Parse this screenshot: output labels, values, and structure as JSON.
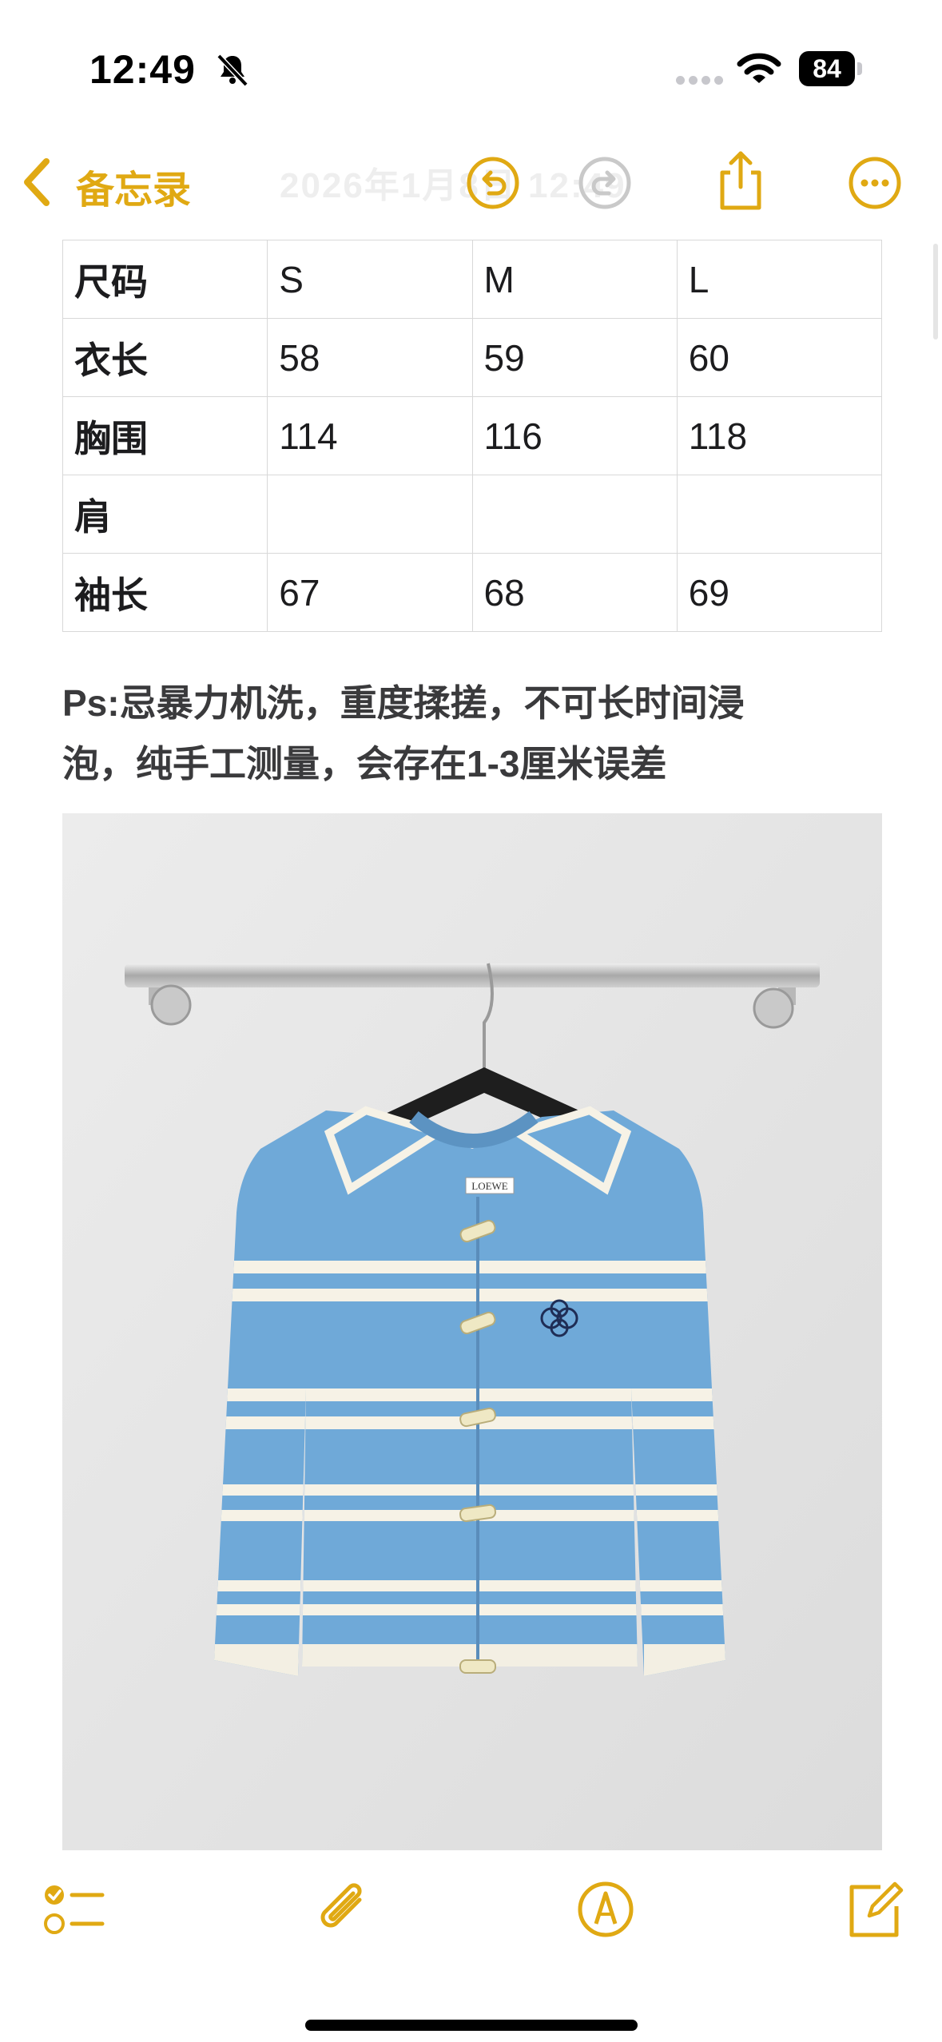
{
  "status_bar": {
    "time": "12:49",
    "battery": "84",
    "icons": [
      "bell-slash-icon",
      "cellular-dots-icon",
      "wifi-icon",
      "battery-icon"
    ]
  },
  "nav": {
    "back_label": "备忘录",
    "ghost_title": "2026年1月8日 12:49",
    "icons": [
      "chevron-left-icon",
      "undo-icon",
      "redo-icon",
      "share-icon",
      "more-icon"
    ]
  },
  "table": {
    "rows": [
      [
        "尺码",
        "S",
        "M",
        "L"
      ],
      [
        "衣长",
        "58",
        "59",
        "60"
      ],
      [
        "胸围",
        "114",
        "116",
        "118"
      ],
      [
        "肩",
        "",
        "",
        ""
      ],
      [
        "袖长",
        "67",
        "68",
        "69"
      ]
    ]
  },
  "note": {
    "line1": "Ps:忌暴力机洗，重度揉搓，不可长时间浸",
    "line2": "泡，纯手工测量，会存在1-3厘米误差"
  },
  "photo": {
    "label_text": "LOEWE",
    "description_name": "product-photo"
  },
  "toolbar": {
    "icons": [
      "checklist-icon",
      "paperclip-icon",
      "markup-pen-icon",
      "compose-icon"
    ]
  },
  "colors": {
    "accent": "#e0a913",
    "sweater_blue": "#6fa9d8",
    "stripe_cream": "#f6f2e6"
  }
}
